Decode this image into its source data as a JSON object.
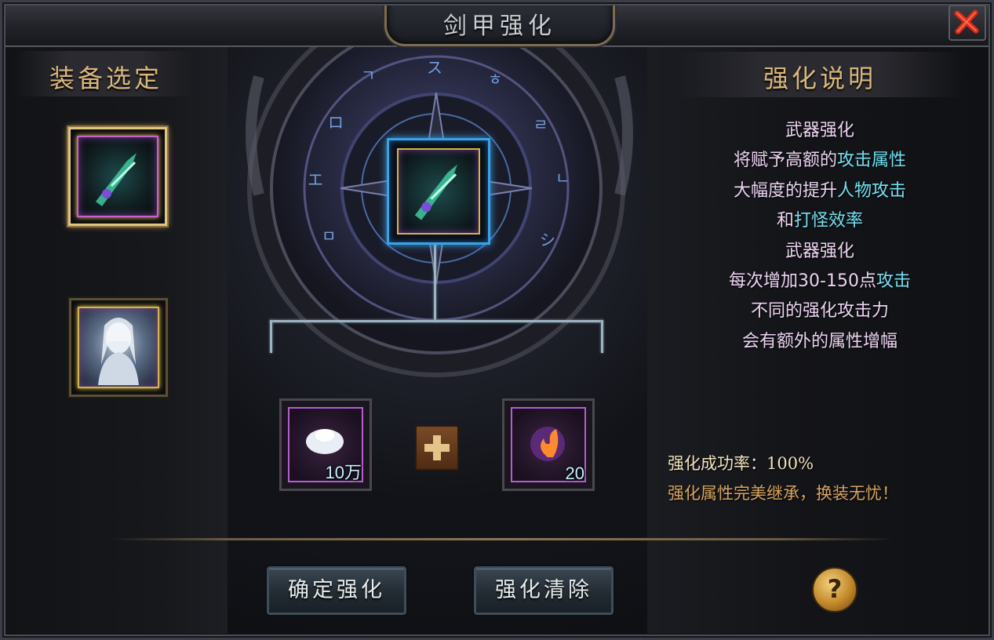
{
  "window": {
    "title": "剑甲强化"
  },
  "left_panel": {
    "title": "装备选定"
  },
  "right_panel": {
    "title": "强化说明",
    "lines": [
      [
        {
          "t": "武器强化",
          "hl": false
        }
      ],
      [
        {
          "t": "将赋予高额的",
          "hl": false
        },
        {
          "t": "攻击属性",
          "hl": true
        }
      ],
      [
        {
          "t": "大幅度的提升",
          "hl": false
        },
        {
          "t": "人物攻击",
          "hl": true
        }
      ],
      [
        {
          "t": "和",
          "hl": false
        },
        {
          "t": "打怪效率",
          "hl": true
        }
      ],
      [
        {
          "t": "武器强化",
          "hl": false
        }
      ],
      [
        {
          "t": "每次增加30-150点",
          "hl": false
        },
        {
          "t": "攻击",
          "hl": true
        }
      ],
      [
        {
          "t": "不同的强化攻击力",
          "hl": false
        }
      ],
      [
        {
          "t": "会有额外的属性增幅",
          "hl": false
        }
      ]
    ],
    "success_rate": "强化成功率：100%",
    "inherit_note": "强化属性完美继承，换装无忧！"
  },
  "materials": [
    {
      "count": "10万",
      "icon": "silver-ingot-icon"
    },
    {
      "count": "20",
      "icon": "fire-orb-icon"
    }
  ],
  "buttons": {
    "confirm": "确定强化",
    "clear": "强化清除",
    "help": "?"
  },
  "colors": {
    "gold": "#d9b77a",
    "highlight": "#6fe2f0",
    "selected_border": "#e0c581",
    "target_border": "#3aa3e8"
  }
}
